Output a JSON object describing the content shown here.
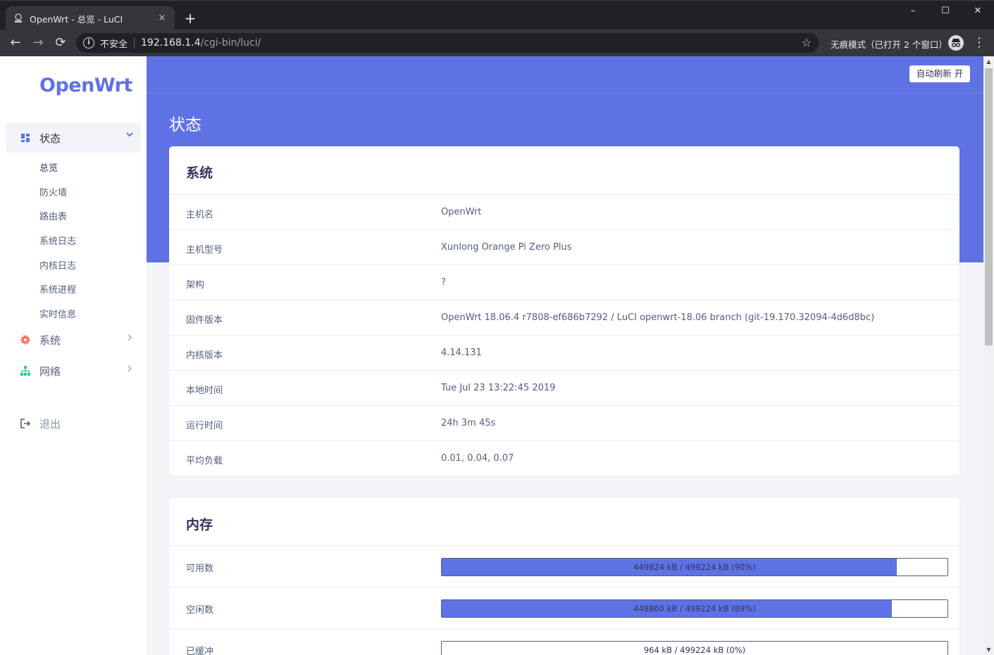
{
  "browser": {
    "tab_title": "OpenWrt - 总览 - LuCI",
    "tab_close": "×",
    "new_tab": "+",
    "window_controls": [
      "–",
      "☐",
      "✕"
    ],
    "nav": {
      "back": "←",
      "forward": "→",
      "reload": "⟳"
    },
    "address": {
      "insecure_label": "不安全",
      "host": "192.168.1.4",
      "path": "/cgi-bin/luci/"
    },
    "incognito_label": "无痕模式（已打开 2 个窗口）",
    "icons": [
      "info-icon",
      "star-icon",
      "incognito-icon",
      "menu-icon"
    ]
  },
  "sidebar": {
    "logo": "OpenWrt",
    "sections": [
      {
        "label": "状态",
        "icon": "dashboard-icon",
        "expanded": true
      },
      {
        "label": "系统",
        "icon": "gear-icon"
      },
      {
        "label": "网络",
        "icon": "network-icon"
      }
    ],
    "status_items": [
      "总览",
      "防火墙",
      "路由表",
      "系统日志",
      "内核日志",
      "系统进程",
      "实时信息"
    ],
    "logout": "退出",
    "accent": "#5e72e4",
    "gear_color": "#fb6340",
    "network_color": "#2dce89"
  },
  "header": {
    "refresh_button": "自动刷新 开",
    "page_title": "状态"
  },
  "system": {
    "title": "系统",
    "rows": [
      {
        "label": "主机名",
        "value": "OpenWrt"
      },
      {
        "label": "主机型号",
        "value": "Xunlong Orange Pi Zero Plus"
      },
      {
        "label": "架构",
        "value": "?"
      },
      {
        "label": "固件版本",
        "value": "OpenWrt 18.06.4 r7808-ef686b7292 / LuCI openwrt-18.06 branch (git-19.170.32094-4d6d8bc)"
      },
      {
        "label": "内核版本",
        "value": "4.14.131"
      },
      {
        "label": "本地时间",
        "value": "Tue Jul 23 13:22:45 2019"
      },
      {
        "label": "运行时间",
        "value": "24h 3m 45s"
      },
      {
        "label": "平均负载",
        "value": "0.01, 0.04, 0.07"
      }
    ]
  },
  "memory": {
    "title": "内存",
    "rows": [
      {
        "label": "可用数",
        "text": "449824 kB / 499224 kB (90%)",
        "percent": 90
      },
      {
        "label": "空闲数",
        "text": "448860 kB / 499224 kB (89%)",
        "percent": 89
      },
      {
        "label": "已缓冲",
        "text": "964 kB / 499224 kB (0%)",
        "percent": 0
      }
    ]
  }
}
